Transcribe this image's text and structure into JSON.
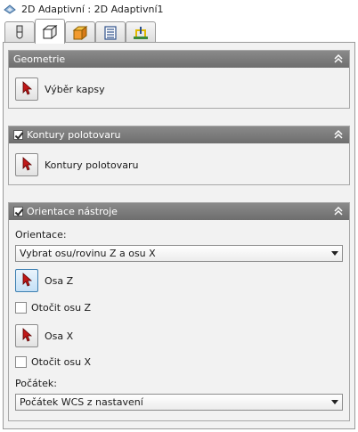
{
  "window": {
    "title": "2D Adaptivní : 2D Adaptivní1"
  },
  "tabs": [
    {
      "icon": "tool-icon",
      "active": false
    },
    {
      "icon": "geometry-icon",
      "active": true
    },
    {
      "icon": "heights-icon",
      "active": false
    },
    {
      "icon": "passes-icon",
      "active": false
    },
    {
      "icon": "linking-icon",
      "active": false
    }
  ],
  "sections": {
    "geometrie": {
      "title": "Geometrie",
      "pick_label": "Výběr kapsy"
    },
    "kontury": {
      "title": "Kontury polotovaru",
      "checked": true,
      "pick_label": "Kontury polotovaru"
    },
    "orientace": {
      "title": "Orientace nástroje",
      "checked": true,
      "orientation_label": "Orientace:",
      "orientation_value": "Vybrat osu/rovinu Z a osu X",
      "axis_z_label": "Osa Z",
      "flip_z_label": "Otočit osu Z",
      "axis_x_label": "Osa X",
      "flip_x_label": "Otočit osu X",
      "origin_label": "Počátek:",
      "origin_value": "Počátek WCS z nastavení"
    }
  },
  "colors": {
    "header_bg": "#7c7c7c",
    "panel_bg": "#f2f2f2",
    "pick_arrow": "#b01818",
    "active_button": "#c4e0f6"
  }
}
